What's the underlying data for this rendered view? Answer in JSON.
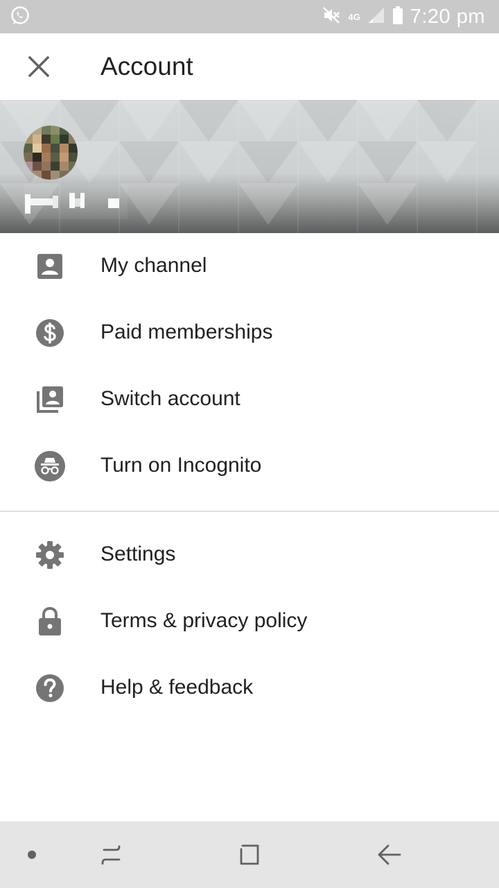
{
  "status_bar": {
    "time": "7:20 pm",
    "network": "4G",
    "icons": [
      "whatsapp-icon",
      "mute-icon",
      "signal-icon",
      "battery-icon"
    ]
  },
  "header": {
    "title": "Account",
    "close_icon": "close-icon"
  },
  "account": {
    "name": "",
    "avatar": "avatar (pixelated)"
  },
  "menu": {
    "section1": [
      {
        "label": "My channel",
        "icon": "account-box-icon"
      },
      {
        "label": "Paid memberships",
        "icon": "dollar-circle-icon"
      },
      {
        "label": "Switch account",
        "icon": "switch-account-icon"
      },
      {
        "label": "Turn on Incognito",
        "icon": "incognito-icon"
      }
    ],
    "section2": [
      {
        "label": "Settings",
        "icon": "gear-icon"
      },
      {
        "label": "Terms & privacy policy",
        "icon": "lock-icon"
      },
      {
        "label": "Help & feedback",
        "icon": "help-icon"
      }
    ]
  },
  "nav_bar": {
    "buttons": [
      "dot-icon",
      "recent-apps-icon",
      "home-icon",
      "back-icon"
    ]
  },
  "colors": {
    "status_bar": "#c9c9c9",
    "icon_gray": "#757575",
    "text": "#212121",
    "nav_bar": "#e5e5e5"
  }
}
